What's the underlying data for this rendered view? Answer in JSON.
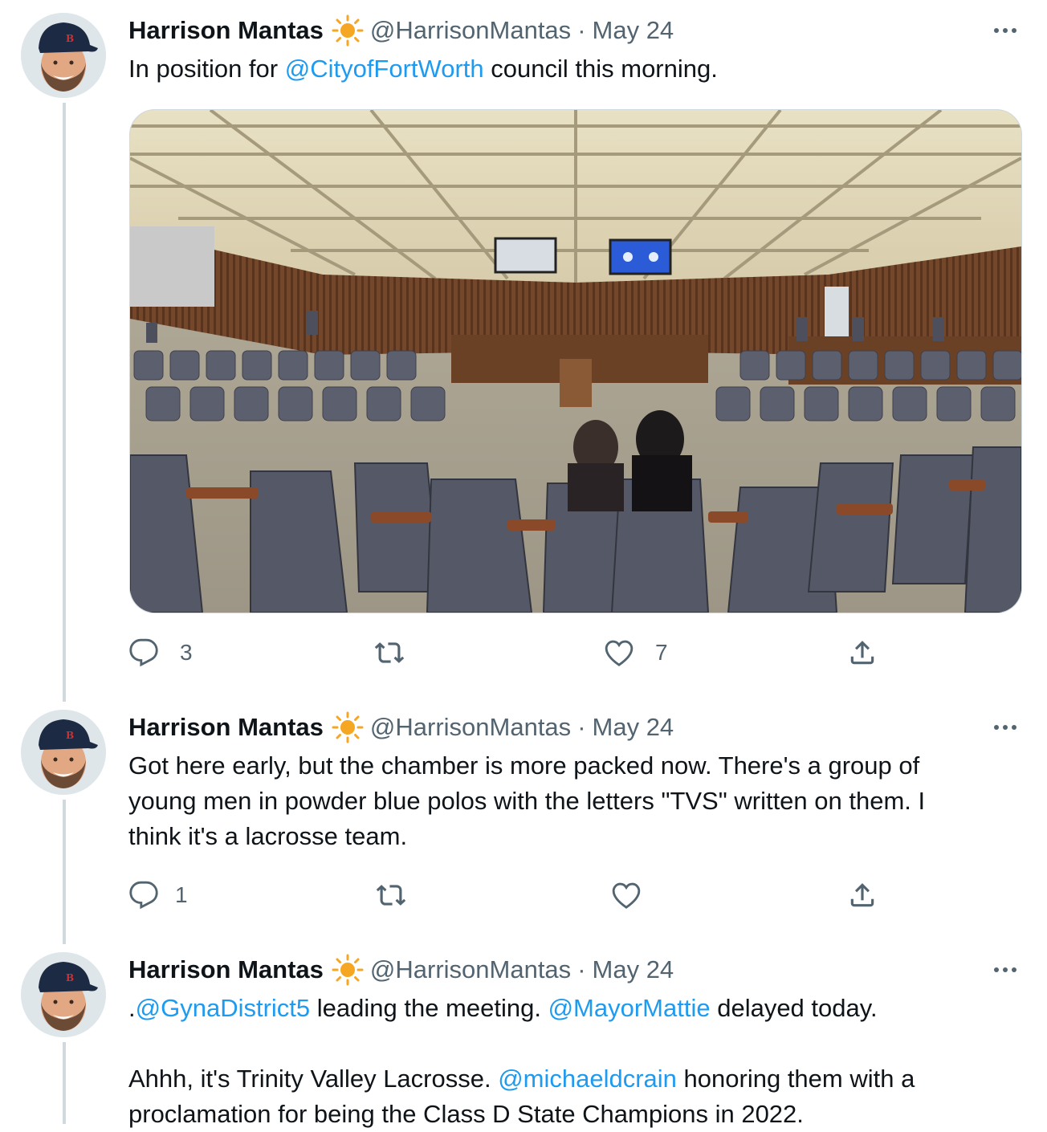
{
  "tweets": [
    {
      "author": "Harrison Mantas",
      "handle": "@HarrisonMantas",
      "separator": "·",
      "date": "May 24",
      "text_parts": [
        {
          "text": "In position for ",
          "type": "text"
        },
        {
          "text": "@CityofFortWorth",
          "type": "mention"
        },
        {
          "text": " council this morning.",
          "type": "text"
        }
      ],
      "media": "council-chamber-photo",
      "reply_count": "3",
      "retweet_count": "",
      "like_count": "7"
    },
    {
      "author": "Harrison Mantas",
      "handle": "@HarrisonMantas",
      "separator": "·",
      "date": "May 24",
      "text_line1": "Got here early, but the chamber is more packed now. There's a group of",
      "text_line2": "young men in powder blue polos with the letters \"TVS\" written on them. I",
      "text_line3": "think it's a lacrosse team.",
      "reply_count": "1",
      "retweet_count": "",
      "like_count": ""
    },
    {
      "author": "Harrison Mantas",
      "handle": "@HarrisonMantas",
      "separator": "·",
      "date": "May 24",
      "line1_prefix": ".",
      "line1_mention1": "@GynaDistrict5",
      "line1_mid": " leading the meeting. ",
      "line1_mention2": "@MayorMattie",
      "line1_suffix": " delayed today.",
      "line2_prefix": "Ahhh, it's Trinity Valley Lacrosse. ",
      "line2_mention": "@michaeldcrain",
      "line2_suffix": " honoring them with a",
      "line3": "proclamation for being the Class D State Champions in 2022."
    }
  ],
  "icons": {
    "verified_badge": "sun-emoji-icon",
    "more": "more-dots-icon",
    "reply": "reply-icon",
    "retweet": "retweet-icon",
    "like": "heart-icon",
    "share": "share-icon"
  },
  "colors": {
    "text": "#0f1419",
    "secondary": "#536471",
    "link": "#1d9bf0",
    "thread_line": "#cfd9de",
    "sun": "#f5a623"
  }
}
